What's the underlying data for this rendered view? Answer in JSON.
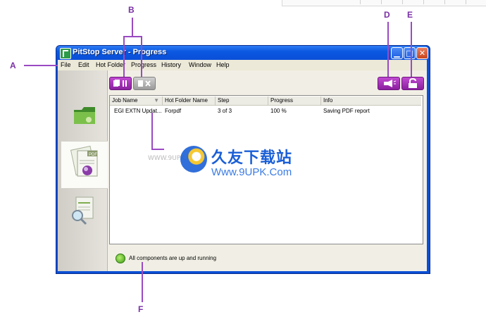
{
  "window": {
    "title": "PitStop Server - Progress",
    "controls": [
      "minimize",
      "maximize",
      "close"
    ]
  },
  "menu": {
    "items": [
      "File",
      "Edit",
      "Hot Folder",
      "Progress",
      "History",
      "Window",
      "Help"
    ]
  },
  "sidebar": {
    "items": [
      {
        "icon": "hot-folder-icon",
        "selected": false
      },
      {
        "icon": "progress-pdf-icon",
        "selected": true
      },
      {
        "icon": "history-report-icon",
        "selected": false
      }
    ]
  },
  "toolbar": {
    "left_buttons": [
      {
        "icon": "pause-icon",
        "enabled": true
      },
      {
        "icon": "cancel-icon",
        "enabled": false
      }
    ],
    "right_buttons": [
      {
        "icon": "announce-icon"
      },
      {
        "icon": "unlock-icon"
      }
    ]
  },
  "table": {
    "columns": [
      "Job Name",
      "Hot Folder Name",
      "Step",
      "Progress",
      "Info"
    ],
    "rows": [
      [
        "EGI EXTN Updat...",
        "Forpdf",
        "3 of 3",
        "100 %",
        "Saving PDF report"
      ]
    ]
  },
  "status": {
    "text": "All components are up and running",
    "color": "#3b9a14"
  },
  "callouts": [
    "A",
    "B",
    "D",
    "E",
    "F"
  ],
  "watermark": {
    "chinese": "久友下载站",
    "url": "Www.9UPK.Com",
    "left_text": "WWW.9UPK.COM"
  },
  "colors": {
    "accent": "#8a1f9e",
    "callout": "#9a4ac2",
    "titlebar": "#0b58e1"
  }
}
